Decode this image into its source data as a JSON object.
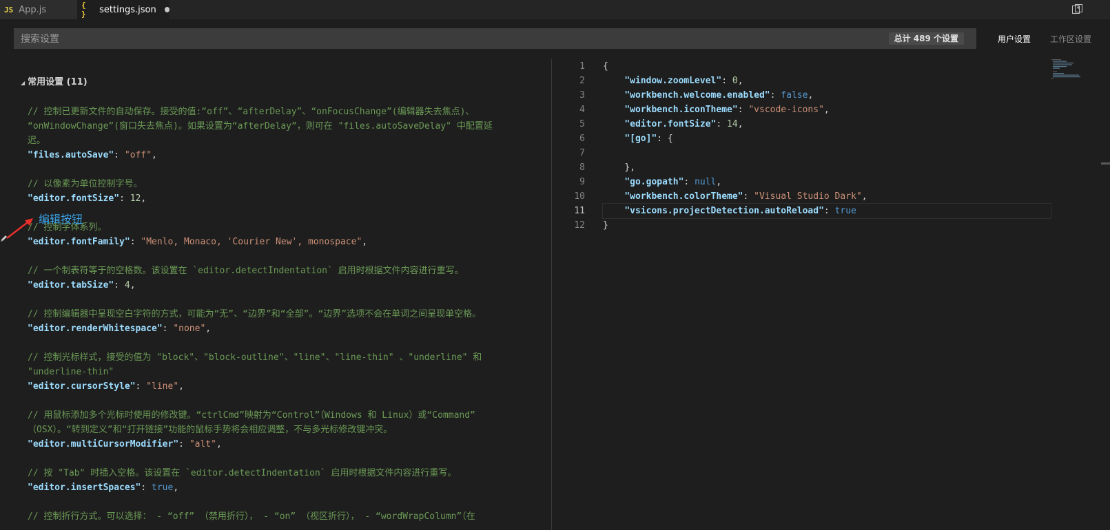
{
  "tabs": [
    {
      "icon": "JS",
      "label": "App.js"
    },
    {
      "icon": "{ }",
      "label": "settings.json"
    }
  ],
  "search": {
    "placeholder": "搜索设置",
    "count": "总计 489 个设置"
  },
  "scopes": {
    "user": "用户设置",
    "workspace": "工作区设置"
  },
  "section": {
    "title": "常用设置 (11)"
  },
  "annotation": {
    "text": "编辑按钮"
  },
  "default_settings": {
    "autosave_comment_1": "// 控制已更新文件的自动保存。接受的值:“off”、“afterDelay”、“onFocusChange”(编辑器失去焦点)、",
    "autosave_comment_2": "“onWindowChange”(窗口失去焦点)。如果设置为“afterDelay”，则可在 \"files.autoSaveDelay\" 中配置延",
    "autosave_comment_3": "迟。",
    "autosave_key": "\"files.autoSave\"",
    "autosave_value": "\"off\"",
    "fontsize_comment": "// 以像素为单位控制字号。",
    "fontsize_key": "\"editor.fontSize\"",
    "fontsize_value": "12",
    "fontfamily_comment": "// 控制字体系列。",
    "fontfamily_key": "\"editor.fontFamily\"",
    "fontfamily_value": "\"Menlo, Monaco, 'Courier New', monospace\"",
    "tabsize_comment": "// 一个制表符等于的空格数。该设置在 `editor.detectIndentation` 启用时根据文件内容进行重写。",
    "tabsize_key": "\"editor.tabSize\"",
    "tabsize_value": "4",
    "whitespace_comment": "// 控制编辑器中呈现空白字符的方式，可能为“无”、“边界”和“全部”。“边界”选项不会在单词之间呈现单空格。",
    "whitespace_key": "\"editor.renderWhitespace\"",
    "whitespace_value": "\"none\"",
    "cursor_comment_1": "// 控制光标样式，接受的值为 \"block\"、\"block-outline\"、\"line\"、\"line-thin\" 、\"underline\" 和",
    "cursor_comment_2": "\"underline-thin\"",
    "cursor_key": "\"editor.cursorStyle\"",
    "cursor_value": "\"line\"",
    "multicursor_comment_1": "// 用鼠标添加多个光标时使用的修改键。“ctrlCmd”映射为“Control”（Windows 和 Linux）或“Command”",
    "multicursor_comment_2": "（OSX）。“转到定义”和“打开链接”功能的鼠标手势将会相应调整，不与多光标修改键冲突。",
    "multicursor_key": "\"editor.multiCursorModifier\"",
    "multicursor_value": "\"alt\"",
    "insertspaces_comment": "// 按 \"Tab\" 时插入空格。该设置在 `editor.detectIndentation` 启用时根据文件内容进行重写。",
    "insertspaces_key": "\"editor.insertSpaces\"",
    "insertspaces_value": "true",
    "wordwrap_comment": "// 控制折行方式。可以选择： - “off” （禁用折行）， - “on” （视区折行）， - “wordWrapColumn”（在"
  },
  "user_settings": {
    "line_numbers": [
      "1",
      "2",
      "3",
      "4",
      "5",
      "6",
      "7",
      "8",
      "9",
      "10",
      "11",
      "12"
    ],
    "open_brace": "{",
    "close_brace": "}",
    "inner_close": "},",
    "zoom_key": "\"window.zoomLevel\"",
    "zoom_value": "0",
    "welcome_key": "\"workbench.welcome.enabled\"",
    "welcome_value": "false",
    "icontheme_key": "\"workbench.iconTheme\"",
    "icontheme_value": "\"vscode-icons\"",
    "fontsize_key": "\"editor.fontSize\"",
    "fontsize_value": "14",
    "go_key": "\"[go]\"",
    "gopath_key": "\"go.gopath\"",
    "gopath_value": "null",
    "colortheme_key": "\"workbench.colorTheme\"",
    "colortheme_value": "\"Visual Studio Dark\"",
    "autoreload_key": "\"vsicons.projectDetection.autoReload\"",
    "autoreload_value": "true"
  },
  "colors": {
    "comment": "#6a9955",
    "key": "#9cdcfe",
    "string": "#ce9178",
    "number": "#b5cea8",
    "keyword": "#569cd6",
    "annotation": "#3ba3e8",
    "arrow": "#e8302a"
  }
}
